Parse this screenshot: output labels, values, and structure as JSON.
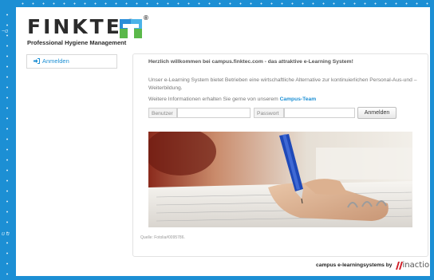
{
  "logo": {
    "word": "FINKTEC",
    "tagline": "Professional Hygiene Management",
    "registered": "®"
  },
  "sidebar": {
    "items": [
      {
        "label": "Anmelden",
        "icon": "sign-in-icon"
      }
    ]
  },
  "main": {
    "welcome": "Herzlich willkommen bei campus.finktec.com - das attraktive e-Learning System!",
    "intro": "Unser e-Learning System bietet Betrieben eine wirtschaftliche Alternative zur kontinuierlichen Personal-Aus-und –Weiterbildung.",
    "more_prefix": "Weitere Informationen erhalten Sie gerne von unserem",
    "more_link": "Campus-Team",
    "image_caption": "Quelle: Fotolia#0095786."
  },
  "login": {
    "user_label": "Benutzer",
    "user_value": "",
    "password_label": "Passwort",
    "password_value": "",
    "button": "Anmelden"
  },
  "footer": {
    "text": "campus e-learningsystems by",
    "brand": "inactio"
  },
  "colors": {
    "frame": "#1c8fd4",
    "link": "#1c8fd4",
    "brand_red": "#d0202a"
  }
}
